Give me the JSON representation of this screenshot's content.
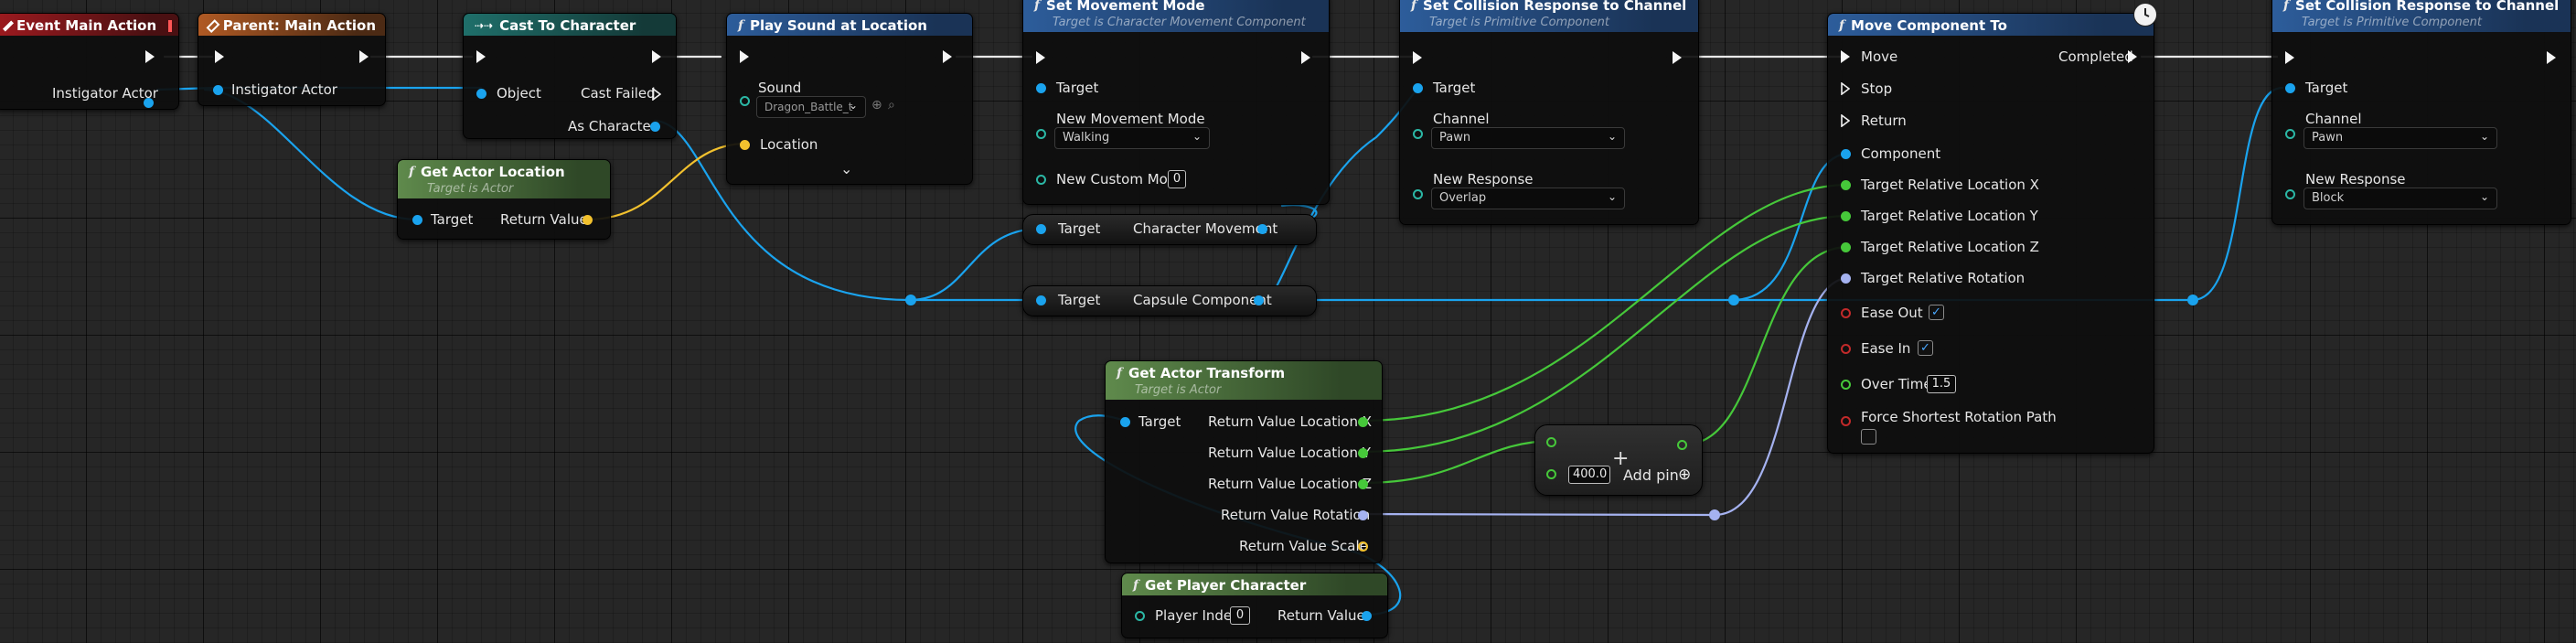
{
  "colors": {
    "exec": "#f5f5f5",
    "object_pin": "#1aa3ee",
    "vector_pin": "#f2c12e",
    "float_pin": "#46c83a",
    "rotator_pin": "#a5b2f0",
    "struct_pin": "#2bb7a5",
    "bool_pin": "#c22a2a"
  },
  "nodes": {
    "event_main": {
      "title": "Event Main Action",
      "pin_instigator": "Instigator Actor",
      "icon": "event-diamond-icon"
    },
    "parent_main": {
      "title": "Parent: Main Action",
      "pin_instigator": "Instigator Actor",
      "icon": "parent-diamond-icon"
    },
    "cast_character": {
      "title": "Cast To Character",
      "pin_object": "Object",
      "pin_cast_failed": "Cast Failed",
      "pin_as_character": "As Character",
      "icon": "cast-arrows-icon"
    },
    "play_sound": {
      "title": "Play Sound at Location",
      "pin_sound": "Sound",
      "sound_value": "Dragon_Battle_t",
      "pin_location": "Location",
      "icon": "function-icon"
    },
    "set_movement_mode": {
      "title": "Set Movement Mode",
      "subtitle": "Target is Character Movement Component",
      "pin_target": "Target",
      "pin_new_mode": "New Movement Mode",
      "mode_value": "Walking",
      "pin_custom_mode": "New Custom Mode",
      "custom_mode_value": "0",
      "icon": "function-icon"
    },
    "char_movement_var": {
      "pin_target": "Target",
      "pin_out": "Character Movement"
    },
    "capsule_var": {
      "pin_target": "Target",
      "pin_out": "Capsule Component"
    },
    "set_collision_1": {
      "title": "Set Collision Response to Channel",
      "subtitle": "Target is Primitive Component",
      "pin_target": "Target",
      "pin_channel": "Channel",
      "channel_value": "Pawn",
      "pin_response": "New Response",
      "response_value": "Overlap",
      "icon": "function-icon"
    },
    "move_component": {
      "title": "Move Component To",
      "pin_move": "Move",
      "pin_stop": "Stop",
      "pin_return": "Return",
      "pin_completed": "Completed",
      "pin_component": "Component",
      "pin_loc_x": "Target Relative Location X",
      "pin_loc_y": "Target Relative Location Y",
      "pin_loc_z": "Target Relative Location Z",
      "pin_rotation": "Target Relative Rotation",
      "pin_ease_out": "Ease Out",
      "pin_ease_in": "Ease In",
      "pin_over_time": "Over Time",
      "over_time_value": "1.5",
      "pin_force_rot": "Force Shortest Rotation Path",
      "icon": "function-icon",
      "latent_icon": "clock-icon"
    },
    "set_collision_2": {
      "title": "Set Collision Response to Channel",
      "subtitle": "Target is Primitive Component",
      "pin_target": "Target",
      "pin_channel": "Channel",
      "channel_value": "Pawn",
      "pin_response": "New Response",
      "response_value": "Block",
      "icon": "function-icon"
    },
    "get_actor_location": {
      "title": "Get Actor Location",
      "subtitle": "Target is Actor",
      "pin_target": "Target",
      "pin_return": "Return Value",
      "icon": "function-icon"
    },
    "get_actor_transform": {
      "title": "Get Actor Transform",
      "subtitle": "Target is Actor",
      "pin_target": "Target",
      "pin_loc_x": "Return Value Location X",
      "pin_loc_y": "Return Value Location Y",
      "pin_loc_z": "Return Value Location Z",
      "pin_rotation": "Return Value Rotation",
      "pin_scale": "Return Value Scale",
      "icon": "function-icon"
    },
    "add_node": {
      "input_value": "400.0",
      "add_pin_label": "Add pin",
      "cursor_icon": "crosshair-cursor-icon",
      "plus_icon": "plus-circle-icon"
    },
    "get_player_character": {
      "title": "Get Player Character",
      "pin_player_index": "Player Index",
      "player_index_value": "0",
      "pin_return": "Return Value",
      "icon": "function-icon"
    }
  }
}
